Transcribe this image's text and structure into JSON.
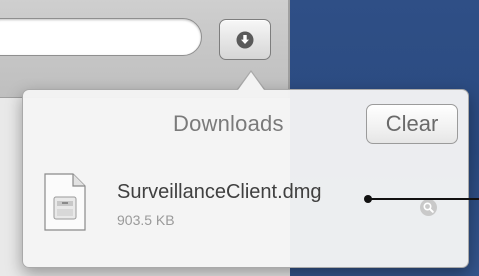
{
  "toolbar": {
    "address_value": "",
    "download_button_icon": "download-arrow-icon"
  },
  "downloads_popover": {
    "title": "Downloads",
    "clear_label": "Clear",
    "items": [
      {
        "file_name": "SurveillanceClient.dmg",
        "file_size": "903.5 KB",
        "file_icon": "disk-image-file-icon",
        "action_icon": "magnifier-reveal-icon"
      }
    ]
  },
  "colors": {
    "desktop_blue": "#2f4f86",
    "popover_background": "#f4f4f4",
    "title_gray": "#7a7a7a",
    "annotation_line": "#111111"
  }
}
